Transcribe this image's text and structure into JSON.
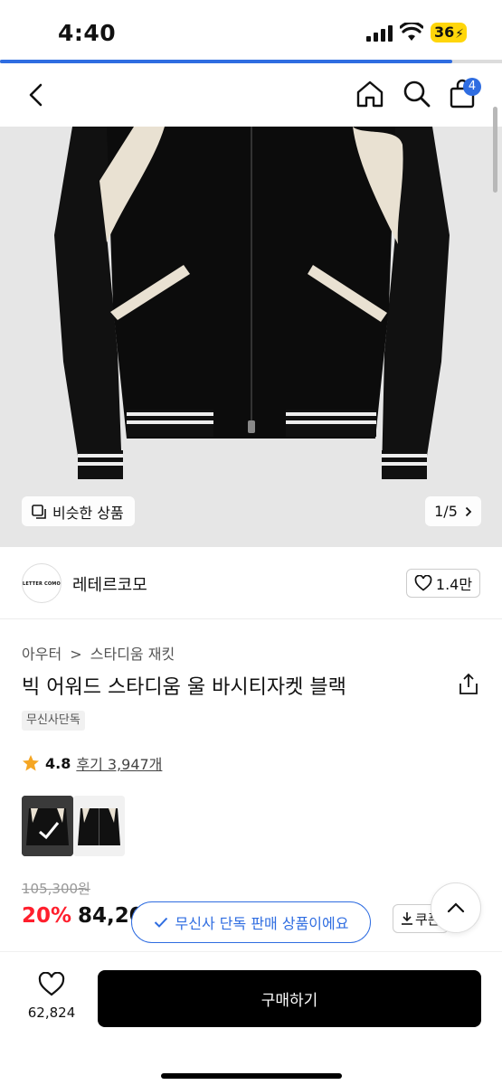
{
  "status": {
    "time": "4:40",
    "battery": "36"
  },
  "loading_progress": 0.9,
  "nav": {
    "cart_count": "4"
  },
  "gallery": {
    "similar_label": "비슷한 상품",
    "pager": "1/5"
  },
  "brand": {
    "logo_text": "LETTER COMO",
    "name": "레테르코모",
    "likes": "1.4만"
  },
  "breadcrumb": {
    "items": [
      "아우터",
      ">",
      "스타디움 재킷"
    ]
  },
  "product": {
    "title": "빅 어워드 스타디움 울 바시티자켓 블랙",
    "tag": "무신사단독",
    "rating": "4.8",
    "review": "후기 3,947개",
    "original_price": "105,300원",
    "discount": "20%",
    "price": "84,20"
  },
  "coupon_label": "쿠폰",
  "toast": "무신사 단독 판매 상품이에요",
  "bottom": {
    "favorites": "62,824",
    "buy_label": "구매하기"
  },
  "colors": {
    "accent": "#2f6de1",
    "sale": "#ff1f2d",
    "battery": "#ffd60a"
  },
  "icons": [
    "back-icon",
    "home-icon",
    "search-icon",
    "cart-icon",
    "similar-icon",
    "chevron-right-icon",
    "heart-icon",
    "share-icon",
    "star-icon",
    "download-icon",
    "check-icon",
    "chevron-up-icon"
  ]
}
